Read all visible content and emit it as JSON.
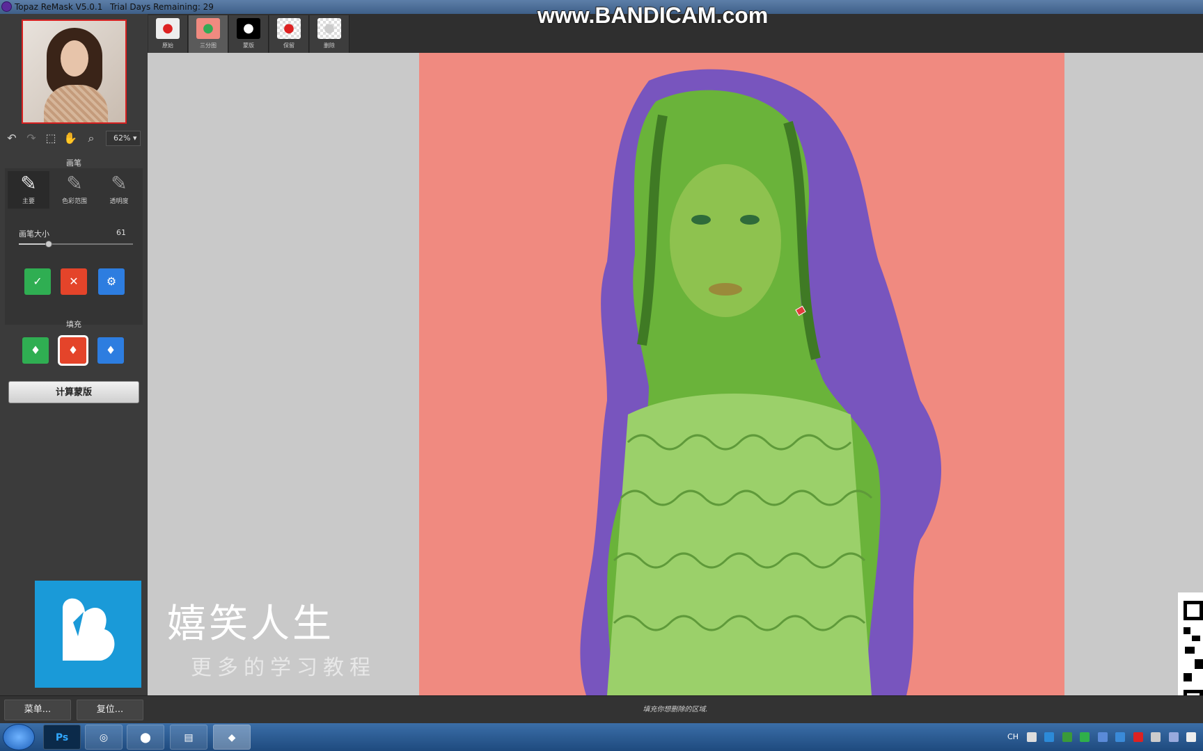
{
  "titlebar": {
    "app_title": "Topaz ReMask V5.0.1",
    "trial": "Trial Days Remaining: 29"
  },
  "watermark": "www.BANDICAM.com",
  "toolbar": {
    "zoom": "62%"
  },
  "brush_section": {
    "title": "画笔",
    "brushes": [
      {
        "label": "主要",
        "icon": "brush-icon"
      },
      {
        "label": "色彩范围",
        "icon": "color-range-brush-icon"
      },
      {
        "label": "透明度",
        "icon": "transparency-brush-icon"
      }
    ],
    "size_label": "画笔大小",
    "size_value": "61",
    "size_fraction": 0.26
  },
  "fill_section": {
    "title": "填充"
  },
  "compute_button": "计算蒙版",
  "tabs": [
    {
      "label": "原始"
    },
    {
      "label": "三分图"
    },
    {
      "label": "蒙版"
    },
    {
      "label": "保留"
    },
    {
      "label": "删除"
    }
  ],
  "overlay": {
    "title": "嬉笑人生",
    "subtitle": "更多的学习教程"
  },
  "bottom": {
    "menu_button": "菜单...",
    "reset_button": "复位...",
    "hint": "填充你想删除的区域."
  },
  "taskbar": {
    "apps": [
      "Ps"
    ],
    "tray_lang": "CH"
  },
  "colors": {
    "keep": "#5fbf3a",
    "compute": "#5a3fb0",
    "drop": "#f08a80"
  }
}
